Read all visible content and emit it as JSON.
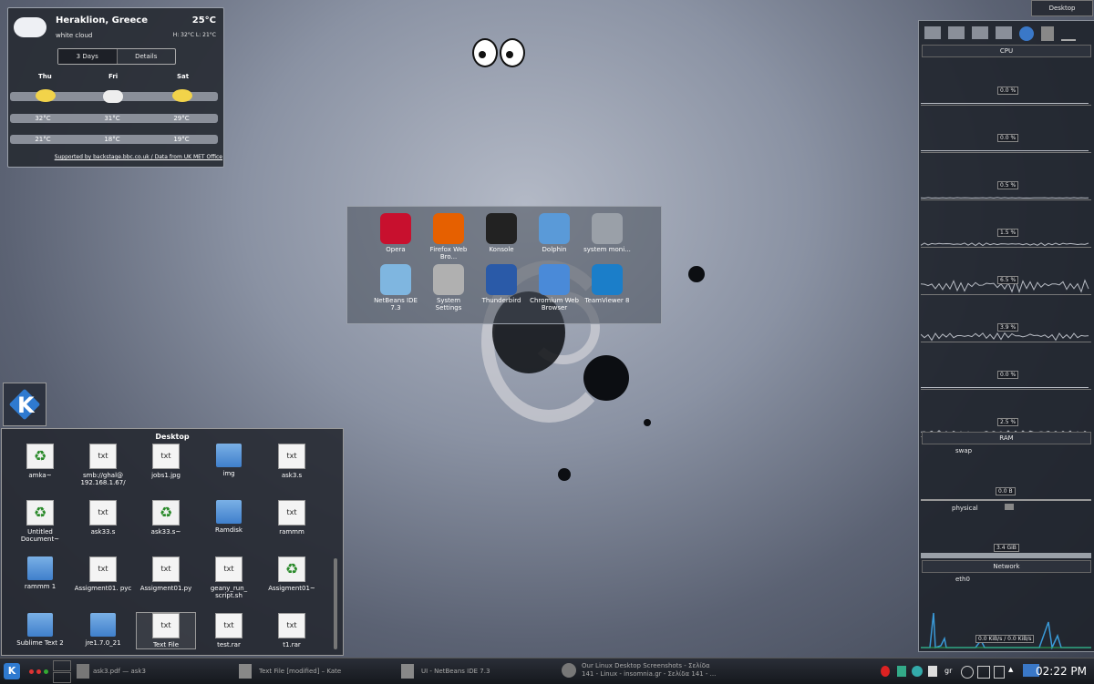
{
  "weather": {
    "city": "Heraklion, Greece",
    "temp": "25°C",
    "condition": "white cloud",
    "hilo": "H: 32°C L: 21°C",
    "tabs": [
      "3 Days",
      "Details"
    ],
    "days": [
      "Thu",
      "Fri",
      "Sat"
    ],
    "highs": [
      "32°C",
      "31°C",
      "29°C"
    ],
    "lows": [
      "21°C",
      "18°C",
      "19°C"
    ],
    "credit": "Supported by backstage.bbc.co.uk / Data from UK MET Office"
  },
  "launcher": {
    "apps": [
      {
        "label": "Opera",
        "color": "#c8102e"
      },
      {
        "label": "Firefox Web Bro...",
        "color": "#e66000"
      },
      {
        "label": "Konsole",
        "color": "#222222"
      },
      {
        "label": "Dolphin",
        "color": "#5a9ad8"
      },
      {
        "label": "system moni...",
        "color": "#9aa0a8"
      },
      {
        "label": "NetBeans IDE 7.3",
        "color": "#7fb6e0"
      },
      {
        "label": "System Settings",
        "color": "#b0b0b0"
      },
      {
        "label": "Thunderbird",
        "color": "#2a5aa8"
      },
      {
        "label": "Chromium Web Browser",
        "color": "#4a8ad8"
      },
      {
        "label": "TeamViewer 8",
        "color": "#1b7ec9"
      }
    ]
  },
  "sysmon": {
    "desktop_button": "Desktop",
    "cpu_label": "CPU",
    "cpu_values": [
      "0.0 %",
      "0.0 %",
      "0.5 %",
      "1.5 %",
      "6.5 %",
      "3.9 %",
      "0.0 %",
      "2.5 %"
    ],
    "ram_label": "RAM",
    "swap_label": "swap",
    "swap_value": "0.0 B",
    "physical_label": "physical",
    "physical_value": "3.4 GiB",
    "network_label": "Network",
    "eth_label": "eth0",
    "net_value": "0.0 KiB/s / 0.0 KiB/s"
  },
  "folderview": {
    "title": "Desktop",
    "items": [
      {
        "label": "amka~",
        "kind": "recycle"
      },
      {
        "label": "smb://ghal@ 192.168.1.67/",
        "kind": "doc"
      },
      {
        "label": "jobs1.jpg",
        "kind": "doc"
      },
      {
        "label": "img",
        "kind": "folder"
      },
      {
        "label": "ask3.s",
        "kind": "doc"
      },
      {
        "label": "Untitled Document~",
        "kind": "recycle"
      },
      {
        "label": "ask33.s",
        "kind": "doc"
      },
      {
        "label": "ask33.s~",
        "kind": "recycle"
      },
      {
        "label": "Ramdisk",
        "kind": "folder"
      },
      {
        "label": "rammm",
        "kind": "doc"
      },
      {
        "label": "rammm 1",
        "kind": "folder"
      },
      {
        "label": "Assigment01. pyc",
        "kind": "doc"
      },
      {
        "label": "Assigment01.py",
        "kind": "doc"
      },
      {
        "label": "geany_run_ script.sh",
        "kind": "doc"
      },
      {
        "label": "Assigment01~",
        "kind": "recycle"
      },
      {
        "label": "Sublime Text 2",
        "kind": "folder"
      },
      {
        "label": "jre1.7.0_21",
        "kind": "folder"
      },
      {
        "label": "Text File",
        "kind": "doc"
      },
      {
        "label": "test.rar",
        "kind": "doc"
      },
      {
        "label": "t1.rar",
        "kind": "doc"
      }
    ]
  },
  "taskbar": {
    "tasks": [
      "ask3.pdf — ask3",
      "Text File [modified] – Kate",
      "UI - NetBeans IDE 7.3",
      "Our Linux Desktop Screenshots - Σελίδα 141 - Linux - insomnia.gr - Σελίδα 141 - ..."
    ],
    "keyboard": "gr",
    "clock": "02:22 PM"
  }
}
